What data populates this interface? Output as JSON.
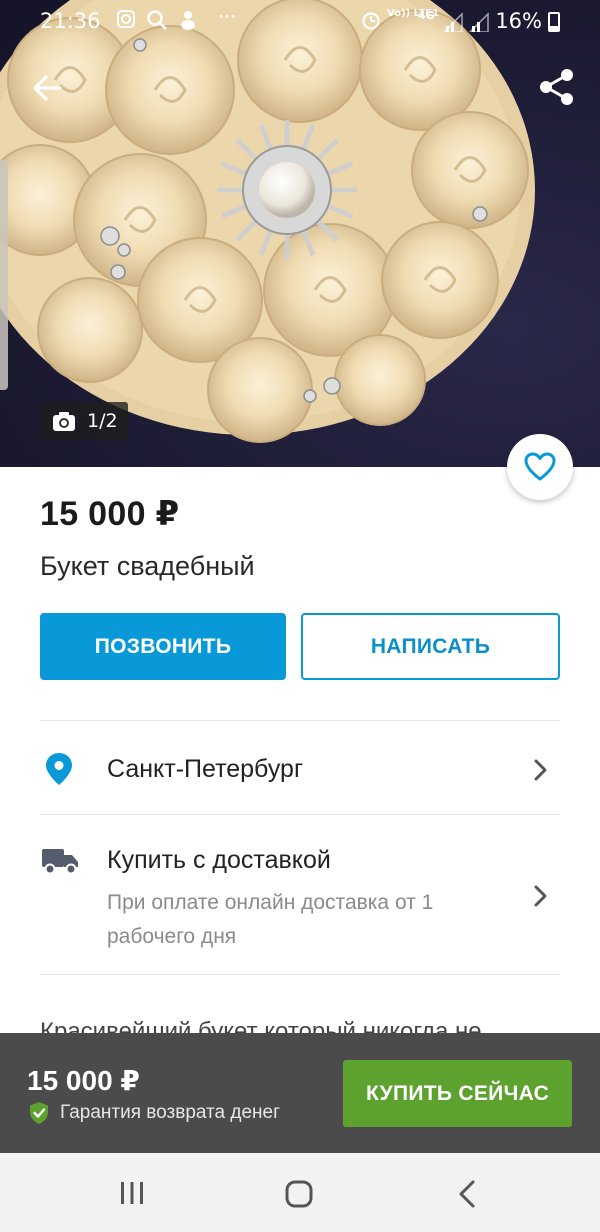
{
  "status_bar": {
    "time": "21:36",
    "network": "4G",
    "volte": "Vo)) LTE1",
    "battery": "16%",
    "icons": [
      "instagram-icon",
      "search-icon",
      "app-icon",
      "more-icon",
      "alarm-icon",
      "signal-icon"
    ]
  },
  "gallery": {
    "counter": "1/2"
  },
  "listing": {
    "price": "15 000 ₽",
    "title": "Букет свадебный"
  },
  "actions": {
    "call_label": "ПОЗВОНИТЬ",
    "write_label": "НАПИСАТЬ"
  },
  "location": {
    "city": "Санкт-Петербург"
  },
  "delivery": {
    "title": "Купить с доставкой",
    "subtitle": "При оплате онлайн доставка от 1 рабочего дня"
  },
  "description": {
    "text": "Красивейший букет который никогда не"
  },
  "buy_bar": {
    "price": "15 000 ₽",
    "guarantee": "Гарантия возврата денег",
    "buy_label": "КУПИТЬ СЕЙЧАС"
  },
  "colors": {
    "accent_blue": "#0a99d8",
    "buy_green": "#5da22f",
    "buy_bar_bg": "#4b4b4b"
  }
}
